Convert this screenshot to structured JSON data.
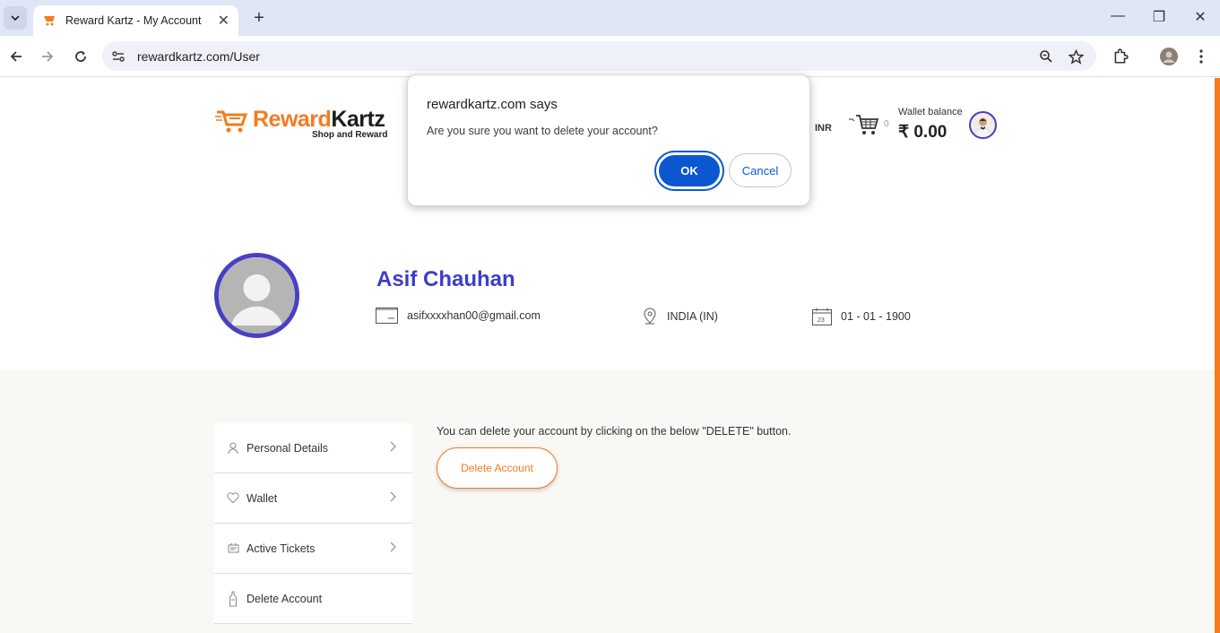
{
  "browser": {
    "tab_title": "Reward Kartz - My Account",
    "url": "rewardkartz.com/User"
  },
  "header": {
    "brand_part1": "Reward",
    "brand_part2": "Kartz",
    "tagline": "Shop and Reward",
    "currency": "INR",
    "cart_count": "0",
    "wallet_label": "Wallet balance",
    "wallet_amount": "₹ 0.00"
  },
  "profile": {
    "name": "Asif Chauhan",
    "email": "asifxxxxhan00@gmail.com",
    "country": "INDIA (IN)",
    "dob": "01 - 01 - 1900"
  },
  "sidebar": {
    "items": [
      {
        "label": "Personal Details"
      },
      {
        "label": "Wallet"
      },
      {
        "label": "Active Tickets"
      },
      {
        "label": "Delete Account"
      }
    ]
  },
  "main": {
    "delete_text": "You can delete your account by clicking on the below \"DELETE\" button.",
    "delete_button": "Delete Account"
  },
  "dialog": {
    "title": "rewardkartz.com says",
    "message": "Are you sure you want to delete your account?",
    "ok_label": "OK",
    "cancel_label": "Cancel"
  },
  "colors": {
    "accent": "#f47b20",
    "profile": "#4a3fc3",
    "dialog_button": "#0b57d0"
  }
}
